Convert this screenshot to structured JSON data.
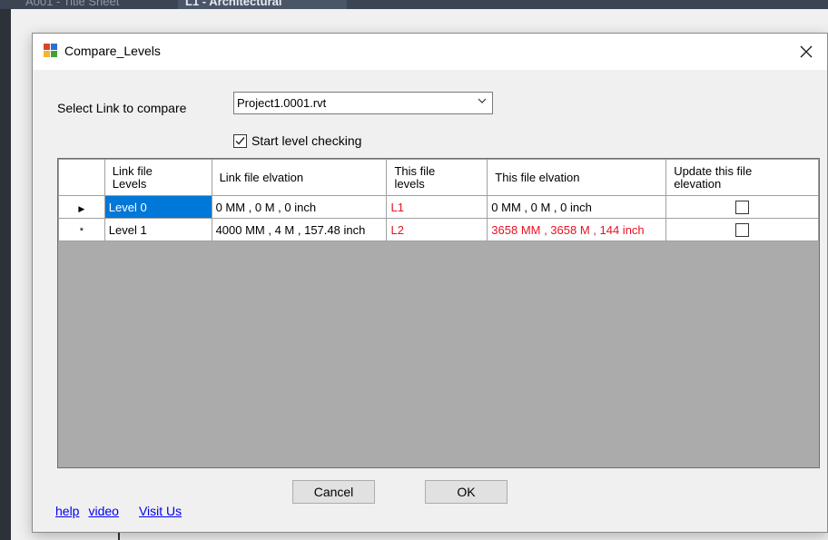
{
  "background": {
    "tabs": [
      "A001 - Title Sheet",
      "L1 - Architectural"
    ]
  },
  "dialog": {
    "title": "Compare_Levels",
    "close_icon": "close-icon",
    "select_link_label": "Select Link to compare",
    "link_combo_value": "Project1.0001.rvt",
    "start_checking_label": "Start level checking",
    "start_checking_checked": true
  },
  "grid": {
    "columns": [
      "Link file Levels",
      "Link file elvation",
      "This file levels",
      "This file elvation",
      "Update this file elevation"
    ],
    "rows": [
      {
        "marker": "▶",
        "link_level": "Level 0",
        "link_elevation": "0 MM  , 0 M  , 0 inch",
        "this_level": "L1",
        "this_elevation": "0 MM  , 0 M  , 0 inch",
        "update": false
      },
      {
        "marker": "*",
        "link_level": "Level 1",
        "link_elevation": "4000 MM  , 4 M  , 157.48 inch",
        "this_level": "L2",
        "this_elevation": "3658 MM  , 3658 M  , 144 inch",
        "update": false
      }
    ]
  },
  "buttons": {
    "cancel": "Cancel",
    "ok": "OK"
  },
  "links": {
    "help": "help",
    "video": "video",
    "visit": "Visit Us"
  },
  "colors": {
    "accent": "#0078d7",
    "mismatch": "#e81123",
    "grid_background": "#ababab"
  }
}
